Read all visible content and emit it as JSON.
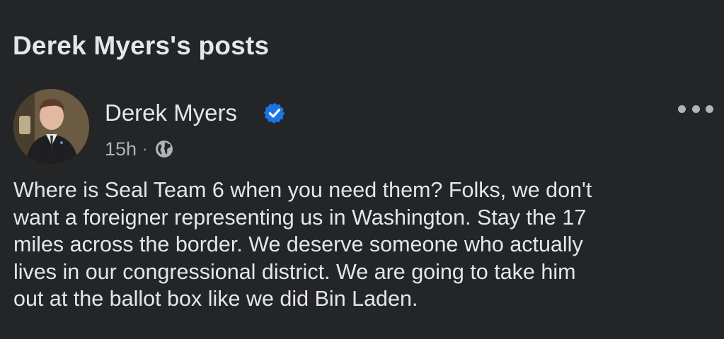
{
  "page": {
    "section_title": "Derek Myers's posts"
  },
  "post": {
    "author": {
      "name": "Derek Myers",
      "verified": true
    },
    "time": "15h",
    "separator": "·",
    "audience_icon": "globe-icon",
    "more_icon": "more-options-icon",
    "text": "Where is Seal Team 6 when you need them? Folks, we don't\nwant a foreigner representing us in Washington. Stay the 17\nmiles across the border. We deserve someone who actually\nlives in our congressional district. We are going to take him\nout at the ballot box like we did Bin Laden."
  },
  "colors": {
    "background": "#242526",
    "text_primary": "#e4e6eb",
    "text_secondary": "#b0b3b8",
    "verified_badge": "#1b74e4"
  }
}
